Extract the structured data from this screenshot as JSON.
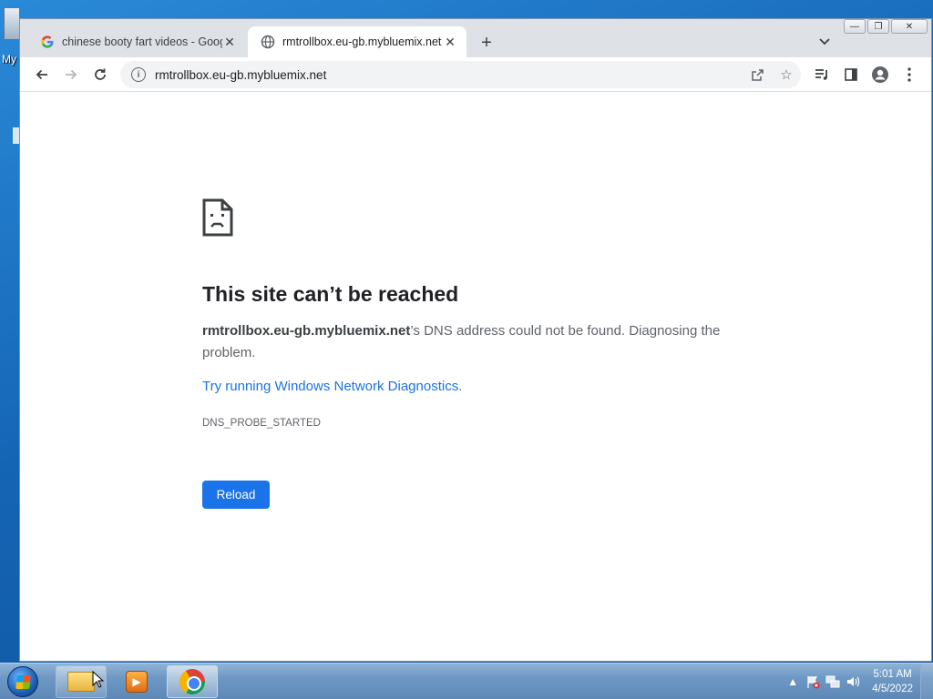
{
  "desktop": {
    "icon_label": "My"
  },
  "browser": {
    "tabs": [
      {
        "title": "chinese booty fart videos - Goog",
        "icon": "google-icon",
        "active": false
      },
      {
        "title": "rmtrollbox.eu-gb.mybluemix.net",
        "icon": "globe-icon",
        "active": true
      }
    ],
    "new_tab_label": "+",
    "omnibox": {
      "url": "rmtrollbox.eu-gb.mybluemix.net"
    },
    "window_controls": {
      "minimize": "—",
      "restore": "❐",
      "close": "✕"
    }
  },
  "error_page": {
    "title": "This site can’t be reached",
    "host": "rmtrollbox.eu-gb.mybluemix.net",
    "description_rest": "’s DNS address could not be found. Diagnosing the problem.",
    "link_text": "Try running Windows Network Diagnostics",
    "link_suffix": ".",
    "error_code": "DNS_PROBE_STARTED",
    "reload_label": "Reload",
    "accent_color": "#1a73e8"
  },
  "taskbar": {
    "clock_time": "5:01 AM",
    "clock_date": "4/5/2022",
    "pinned": [
      "file-explorer-icon",
      "media-player-icon",
      "chrome-icon"
    ]
  }
}
